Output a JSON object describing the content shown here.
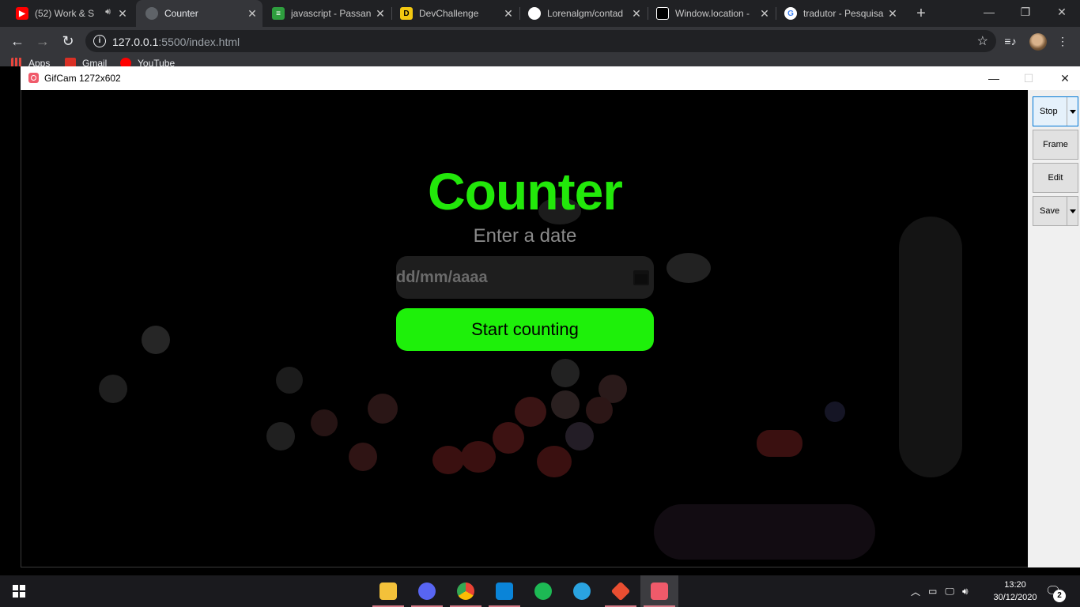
{
  "browser": {
    "tabs": [
      {
        "title": "(52) Work & S",
        "favicon": "youtube-icon",
        "color": "#ff0000"
      },
      {
        "title": "Counter",
        "favicon": "globe-icon",
        "color": "#5f6368"
      },
      {
        "title": "javascript - Passan",
        "favicon": "stackoverflow-icon",
        "color": "#2e9e3e"
      },
      {
        "title": "DevChallenge",
        "favicon": "devchallenge-icon",
        "color": "#f2c811"
      },
      {
        "title": "Lorenalgm/contad",
        "favicon": "github-icon",
        "color": "#ffffff"
      },
      {
        "title": "Window.location -",
        "favicon": "mdn-icon",
        "color": "#000000"
      },
      {
        "title": "tradutor - Pesquisa",
        "favicon": "google-icon",
        "color": "#4285f4"
      }
    ],
    "url_host": "127.0.0.1",
    "url_path": ":5500/index.html",
    "bookmarks": [
      "Apps",
      "Gmail",
      "YouTube"
    ]
  },
  "gifcam": {
    "title": "GifCam 1272x602",
    "buttons": {
      "stop": "Stop",
      "frame": "Frame",
      "edit": "Edit",
      "save": "Save"
    }
  },
  "page": {
    "title": "Counter",
    "subtitle": "Enter a date",
    "date_placeholder": "dd/mm/aaaa",
    "button": "Start counting",
    "accent": "#22e80a"
  },
  "taskbar": {
    "apps": [
      {
        "name": "file-explorer-icon",
        "color": "#f3c13a"
      },
      {
        "name": "discord-icon",
        "color": "#5865f2"
      },
      {
        "name": "chrome-icon",
        "color": "#4285f4"
      },
      {
        "name": "vscode-icon",
        "color": "#0a84d8"
      },
      {
        "name": "spotify-icon",
        "color": "#1db954"
      },
      {
        "name": "telegram-icon",
        "color": "#2aa3e0"
      },
      {
        "name": "git-icon",
        "color": "#e94e31"
      },
      {
        "name": "gifcam-icon",
        "color": "#f05a6a"
      }
    ],
    "time": "13:20",
    "date": "30/12/2020",
    "notifications": "2"
  }
}
